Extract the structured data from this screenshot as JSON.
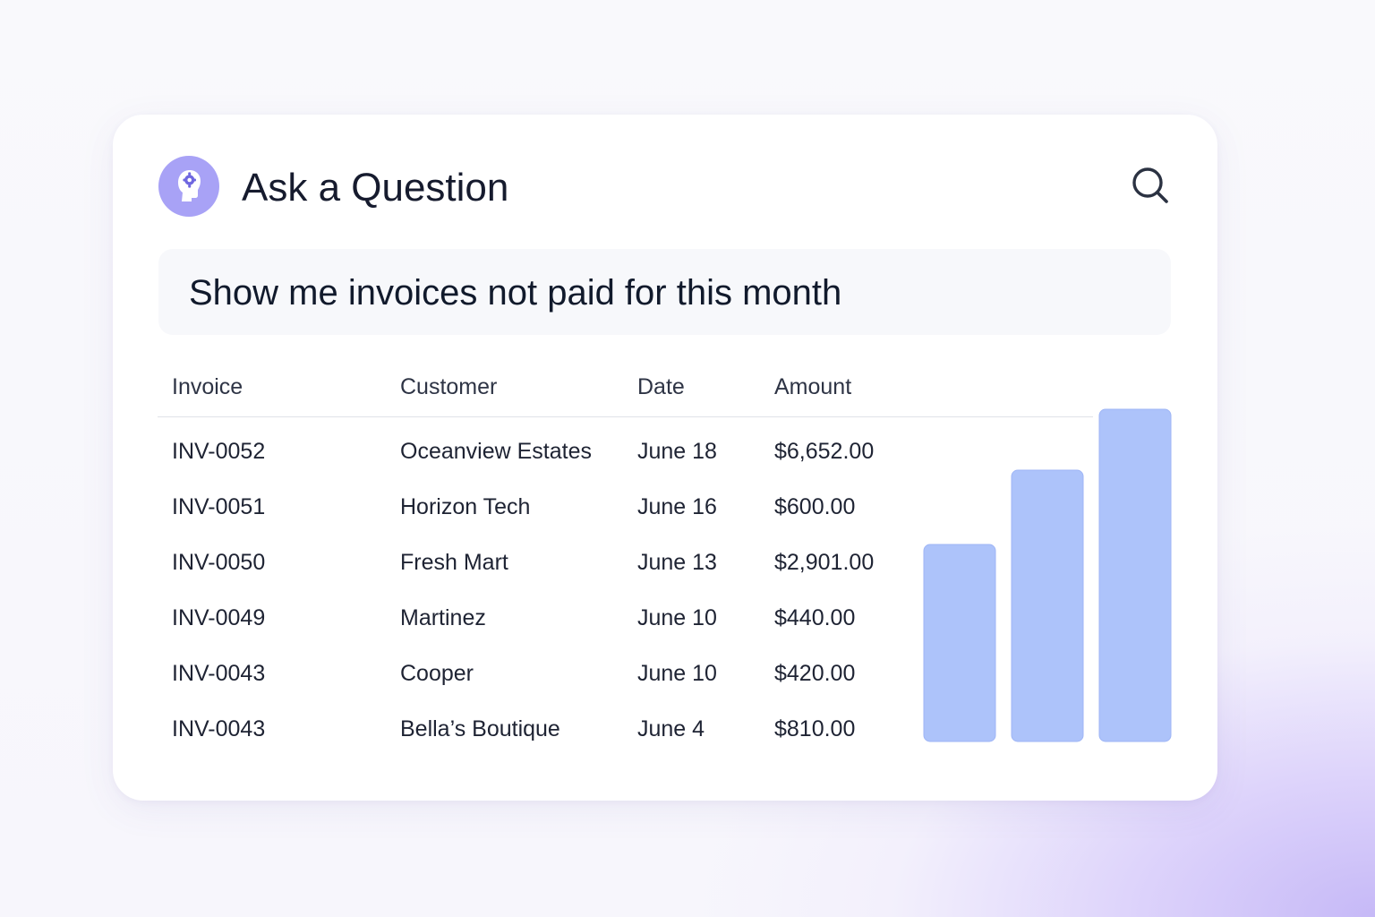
{
  "header": {
    "title": "Ask a Question",
    "avatar_icon": "brain-gear-icon",
    "search_icon": "search-icon"
  },
  "query": {
    "text": "Show me invoices not paid for this month"
  },
  "table": {
    "columns": [
      "Invoice",
      "Customer",
      "Date",
      "Amount"
    ],
    "rows": [
      [
        "INV-0052",
        "Oceanview Estates",
        "June 18",
        "$6,652.00"
      ],
      [
        "INV-0051",
        "Horizon Tech",
        "June 16",
        "$600.00"
      ],
      [
        "INV-0050",
        "Fresh Mart",
        "June 13",
        "$2,901.00"
      ],
      [
        "INV-0049",
        "Martinez",
        "June 10",
        "$440.00"
      ],
      [
        "INV-0043",
        "Cooper",
        "June 10",
        "$420.00"
      ],
      [
        "INV-0043",
        "Bella’s Boutique",
        "June 4",
        "$810.00"
      ]
    ]
  },
  "chart_data": {
    "type": "bar",
    "values": [
      220,
      303,
      371
    ],
    "ylim": [
      0,
      380
    ],
    "color": "#adc3fa"
  },
  "colors": {
    "accent": "#a8a2f6",
    "bar": "#adc3fa"
  }
}
